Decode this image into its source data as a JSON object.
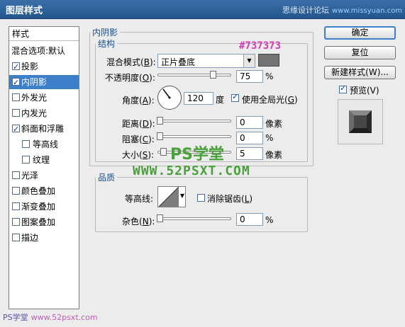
{
  "window": {
    "title": "图层样式",
    "watermark_text": "思缘设计论坛",
    "watermark_site": "www.missyuan.com"
  },
  "sidebar": {
    "header": "样式",
    "items": [
      {
        "label": "混合选项:默认",
        "checkbox": false,
        "checked": false,
        "selected": false,
        "indent": false
      },
      {
        "label": "投影",
        "checkbox": true,
        "checked": true,
        "selected": false,
        "indent": false
      },
      {
        "label": "内阴影",
        "checkbox": true,
        "checked": true,
        "selected": true,
        "indent": false
      },
      {
        "label": "外发光",
        "checkbox": true,
        "checked": false,
        "selected": false,
        "indent": false
      },
      {
        "label": "内发光",
        "checkbox": true,
        "checked": false,
        "selected": false,
        "indent": false
      },
      {
        "label": "斜面和浮雕",
        "checkbox": true,
        "checked": true,
        "selected": false,
        "indent": false
      },
      {
        "label": "等高线",
        "checkbox": true,
        "checked": false,
        "selected": false,
        "indent": true
      },
      {
        "label": "纹理",
        "checkbox": true,
        "checked": false,
        "selected": false,
        "indent": true
      },
      {
        "label": "光泽",
        "checkbox": true,
        "checked": false,
        "selected": false,
        "indent": false
      },
      {
        "label": "颜色叠加",
        "checkbox": true,
        "checked": false,
        "selected": false,
        "indent": false
      },
      {
        "label": "渐变叠加",
        "checkbox": true,
        "checked": false,
        "selected": false,
        "indent": false
      },
      {
        "label": "图案叠加",
        "checkbox": true,
        "checked": false,
        "selected": false,
        "indent": false
      },
      {
        "label": "描边",
        "checkbox": true,
        "checked": false,
        "selected": false,
        "indent": false
      }
    ]
  },
  "inner_shadow": {
    "section_title": "内阴影",
    "structure": {
      "title": "结构",
      "blend_mode_label": "混合模式",
      "blend_mode_key": "B",
      "blend_mode_value": "正片叠底",
      "color_hex_label": "#737373",
      "color": "#737373",
      "opacity_label": "不透明度",
      "opacity_key": "O",
      "opacity_value": "75",
      "opacity_fraction": 0.75,
      "percent": "%",
      "angle_label": "角度",
      "angle_key": "A",
      "angle_value": "120",
      "angle_unit": "度",
      "use_global_light": "使用全局光",
      "use_global_light_key": "G",
      "use_global_light_checked": true,
      "distance_label": "距离",
      "distance_key": "D",
      "distance_value": "0",
      "distance_unit": "像素",
      "choke_label": "阻塞",
      "choke_key": "C",
      "choke_value": "0",
      "size_label": "大小",
      "size_key": "S",
      "size_value": "5",
      "size_unit": "像素"
    },
    "quality": {
      "title": "品质",
      "contour_label": "等高线",
      "anti_alias_label": "消除锯齿",
      "anti_alias_key": "L",
      "anti_alias_checked": false,
      "noise_label": "杂色",
      "noise_key": "N",
      "noise_value": "0",
      "noise_fraction": 0.0
    }
  },
  "buttons": {
    "ok": "确定",
    "reset": "复位",
    "new_style": "新建样式(W)...",
    "preview_label": "预览(V)",
    "preview_checked": true
  },
  "overlay_watermarks": {
    "ps_school": "PS学堂",
    "site": "WWW.52PSXT.COM",
    "bottom_brand": "PS学堂",
    "bottom_site": "www.52psxt.com"
  }
}
